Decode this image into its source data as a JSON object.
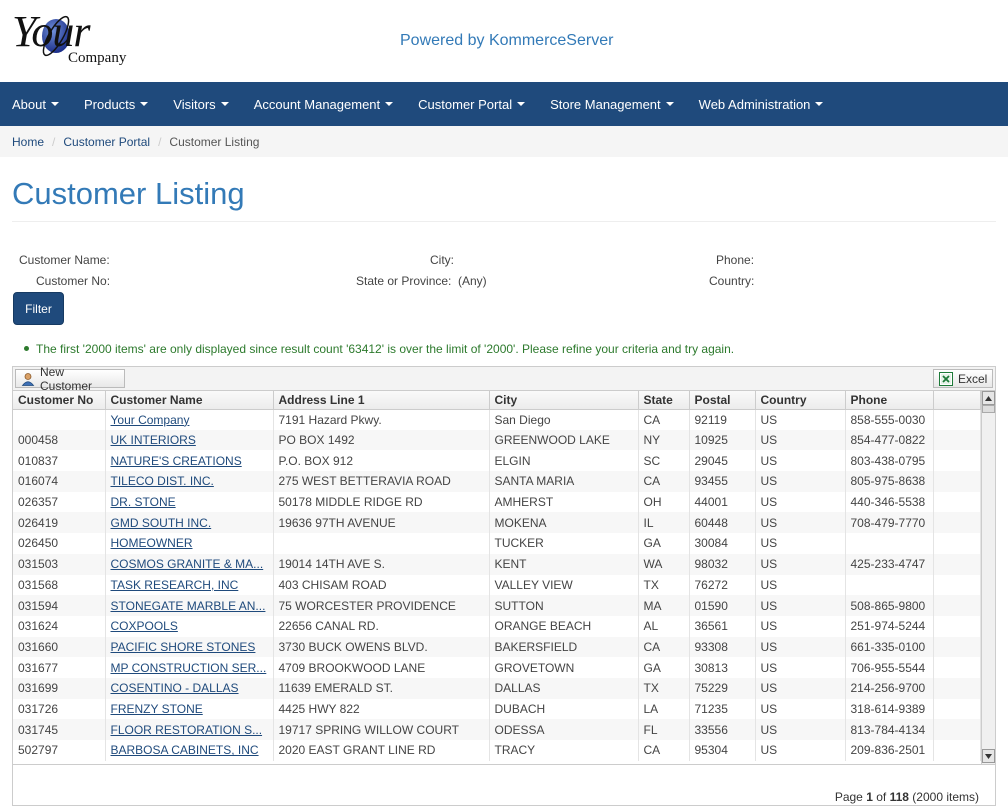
{
  "header": {
    "logo_text_main": "Your",
    "logo_text_sub": "Company",
    "powered_by": "Powered by KommerceServer"
  },
  "nav": [
    {
      "label": "About"
    },
    {
      "label": "Products"
    },
    {
      "label": "Visitors"
    },
    {
      "label": "Account Management"
    },
    {
      "label": "Customer Portal"
    },
    {
      "label": "Store Management"
    },
    {
      "label": "Web Administration"
    }
  ],
  "breadcrumb": {
    "home": "Home",
    "parent": "Customer Portal",
    "current": "Customer Listing"
  },
  "page_title": "Customer Listing",
  "filters": {
    "customer_name_label": "Customer Name:",
    "customer_no_label": "Customer No:",
    "city_label": "City:",
    "state_label": "State or Province:",
    "state_value": "(Any)",
    "phone_label": "Phone:",
    "country_label": "Country:",
    "filter_button": "Filter"
  },
  "notice": "The first '2000 items' are only displayed since result count '63412' is over the limit of '2000'. Please refine your criteria and try again.",
  "toolbar": {
    "new_customer": "New Customer",
    "excel": "Excel"
  },
  "columns": [
    "Customer No",
    "Customer Name",
    "Address Line 1",
    "City",
    "State",
    "Postal",
    "Country",
    "Phone"
  ],
  "rows": [
    [
      "",
      "Your Company",
      "7191 Hazard Pkwy.",
      "San Diego",
      "CA",
      "92119",
      "US",
      "858-555-0030"
    ],
    [
      "000458",
      "UK INTERIORS",
      "PO BOX 1492",
      "GREENWOOD LAKE",
      "NY",
      "10925",
      "US",
      "854-477-0822"
    ],
    [
      "010837",
      "NATURE'S CREATIONS",
      "P.O. BOX 912",
      "ELGIN",
      "SC",
      "29045",
      "US",
      "803-438-0795"
    ],
    [
      "016074",
      "TILECO DIST. INC.",
      "275 WEST BETTERAVIA ROAD",
      "SANTA MARIA",
      "CA",
      "93455",
      "US",
      "805-975-8638"
    ],
    [
      "026357",
      "DR. STONE",
      "50178 MIDDLE RIDGE RD",
      "AMHERST",
      "OH",
      "44001",
      "US",
      "440-346-5538"
    ],
    [
      "026419",
      "GMD SOUTH INC.",
      "19636 97TH AVENUE",
      "MOKENA",
      "IL",
      "60448",
      "US",
      "708-479-7770"
    ],
    [
      "026450",
      "HOMEOWNER",
      "",
      "TUCKER",
      "GA",
      "30084",
      "US",
      ""
    ],
    [
      "031503",
      "COSMOS GRANITE & MA...",
      "19014 14TH AVE S.",
      "KENT",
      "WA",
      "98032",
      "US",
      "425-233-4747"
    ],
    [
      "031568",
      "TASK RESEARCH, INC",
      "403 CHISAM ROAD",
      "VALLEY VIEW",
      "TX",
      "76272",
      "US",
      ""
    ],
    [
      "031594",
      "STONEGATE MARBLE AN...",
      "75 WORCESTER PROVIDENCE",
      "SUTTON",
      "MA",
      "01590",
      "US",
      "508-865-9800"
    ],
    [
      "031624",
      "COXPOOLS",
      "22656 CANAL RD.",
      "ORANGE BEACH",
      "AL",
      "36561",
      "US",
      "251-974-5244"
    ],
    [
      "031660",
      "PACIFIC SHORE STONES",
      "3730 BUCK OWENS BLVD.",
      "BAKERSFIELD",
      "CA",
      "93308",
      "US",
      "661-335-0100"
    ],
    [
      "031677",
      "MP CONSTRUCTION SER...",
      "4709 BROOKWOOD LANE",
      "GROVETOWN",
      "GA",
      "30813",
      "US",
      "706-955-5544"
    ],
    [
      "031699",
      "COSENTINO - DALLAS",
      "11639 EMERALD ST.",
      "DALLAS",
      "TX",
      "75229",
      "US",
      "214-256-9700"
    ],
    [
      "031726",
      "FRENZY STONE",
      "4425 HWY 822",
      "DUBACH",
      "LA",
      "71235",
      "US",
      "318-614-9389"
    ],
    [
      "031745",
      "FLOOR RESTORATION S...",
      "19717 SPRING WILLOW COURT",
      "ODESSA",
      "FL",
      "33556",
      "US",
      "813-784-4134"
    ],
    [
      "502797",
      "BARBOSA CABINETS, INC",
      "2020 EAST GRANT LINE RD",
      "TRACY",
      "CA",
      "95304",
      "US",
      "209-836-2501"
    ]
  ],
  "pager": {
    "page_word": "Page",
    "page": "1",
    "of_word": "of",
    "total_pages": "118",
    "items": "(2000 items)"
  }
}
